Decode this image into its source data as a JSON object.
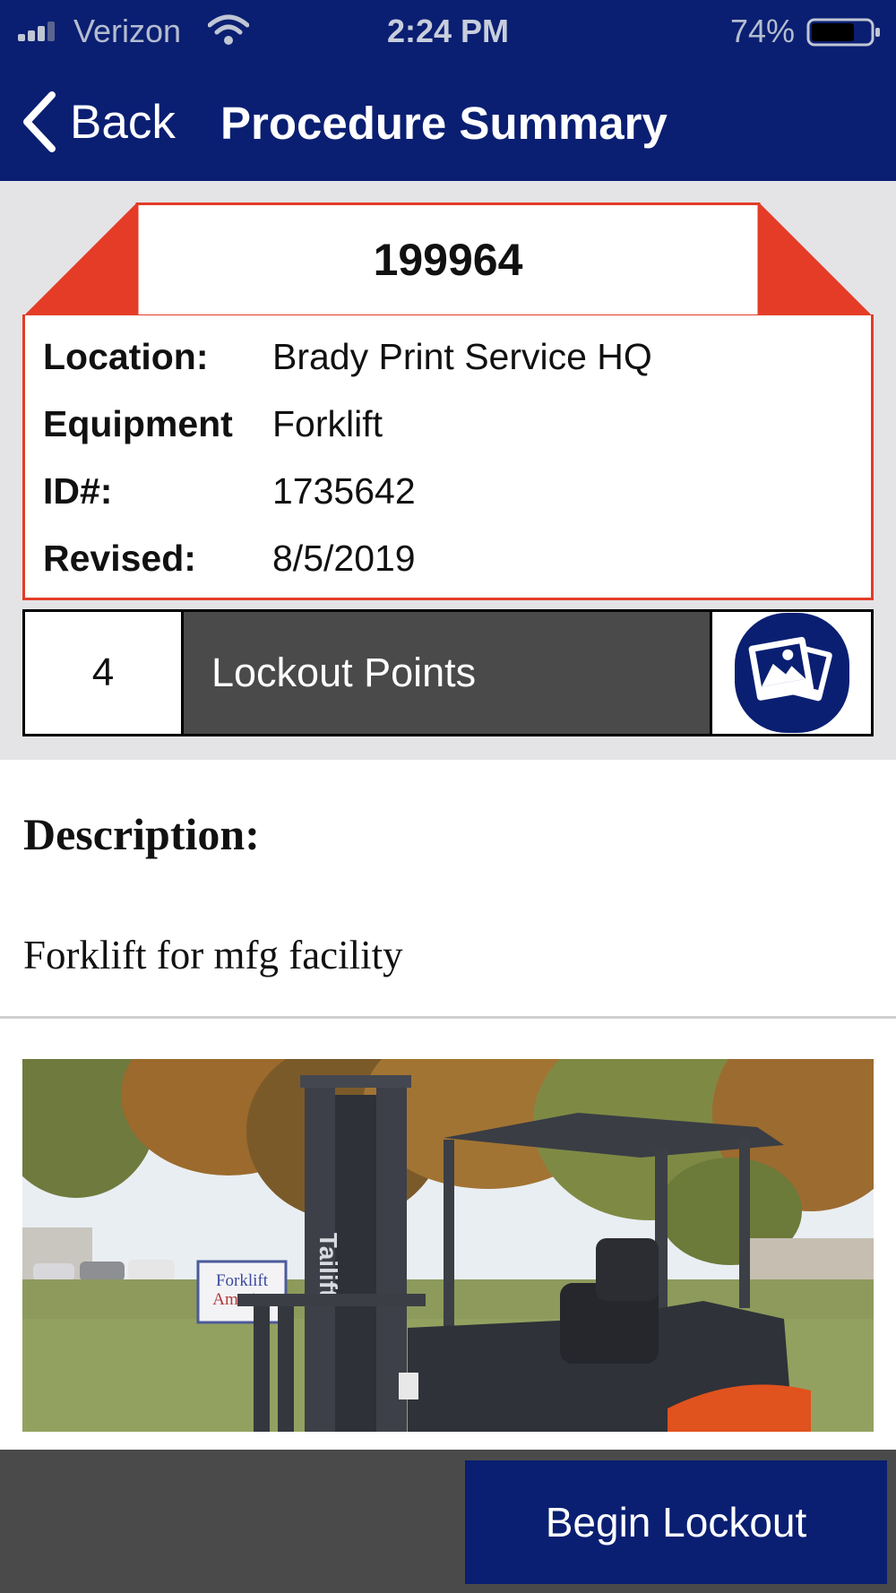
{
  "status_bar": {
    "carrier": "Verizon",
    "time": "2:24 PM",
    "battery_percent": "74%",
    "battery_level": 0.74,
    "icons": [
      "signal-icon",
      "wifi-icon",
      "battery-icon"
    ]
  },
  "nav": {
    "back_label": "Back",
    "title": "Procedure Summary",
    "back_icon": "chevron-left-icon"
  },
  "procedure": {
    "number": "199964",
    "fields": [
      {
        "label": "Location:",
        "value": "Brady Print Service HQ"
      },
      {
        "label": "Equipment",
        "value": "Forklift"
      },
      {
        "label": "ID#:",
        "value": "1735642"
      },
      {
        "label": "Revised:",
        "value": "8/5/2019"
      }
    ]
  },
  "lockout": {
    "count": "4",
    "label": "Lockout Points",
    "photos_icon": "photo-gallery-icon"
  },
  "description": {
    "heading": "Description:",
    "text": "Forklift for mfg facility"
  },
  "photo": {
    "sign_line1": "Forklift",
    "sign_line2": "America",
    "mast_brand": "Tailift"
  },
  "actions": {
    "begin_label": "Begin Lockout"
  },
  "colors": {
    "header_blue": "#0a1f72",
    "tag_red": "#e43c27",
    "dark_gray": "#4a4a4a",
    "background_gray": "#e4e4e6"
  }
}
